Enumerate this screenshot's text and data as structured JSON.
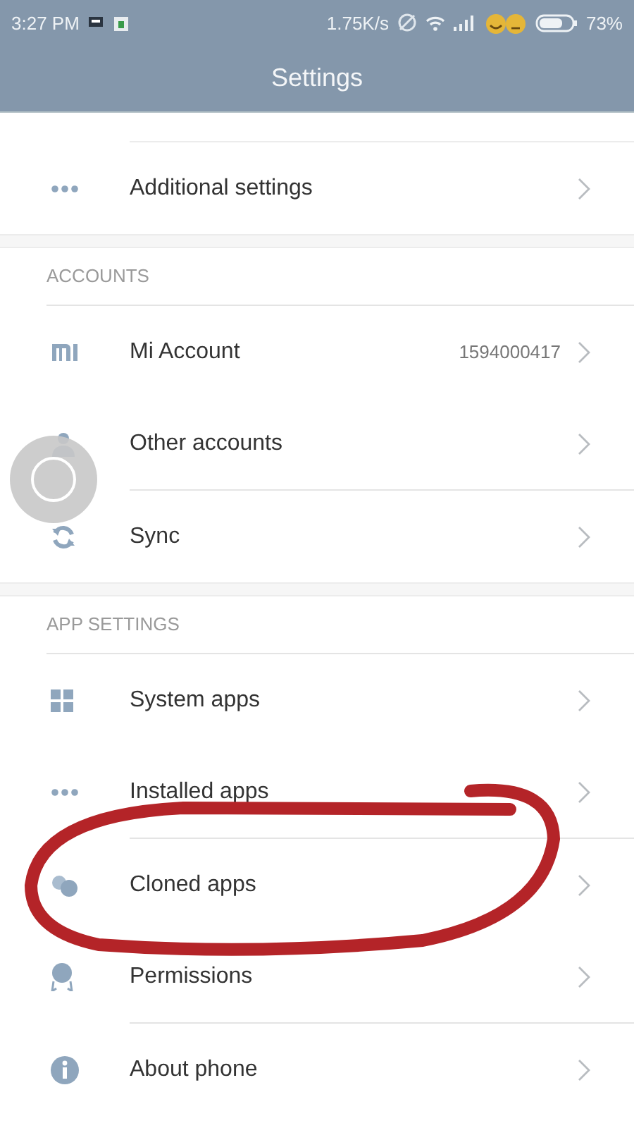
{
  "status_bar": {
    "time": "3:27 PM",
    "speed": "1.75K/s",
    "battery": "73%"
  },
  "window": {
    "title": "Settings"
  },
  "sections": [
    {
      "groups": [
        [
          {
            "label": "Additional settings"
          }
        ]
      ]
    },
    {
      "header": "ACCOUNTS",
      "groups": [
        [
          {
            "label": "Mi Account",
            "value": "1594000417"
          },
          {
            "label": "Other accounts"
          }
        ],
        [
          {
            "label": "Sync"
          }
        ]
      ]
    },
    {
      "header": "APP SETTINGS",
      "groups": [
        [
          {
            "label": "System apps"
          },
          {
            "label": "Installed apps"
          }
        ],
        [
          {
            "label": "Cloned apps"
          },
          {
            "label": "Permissions"
          }
        ],
        [
          {
            "label": "About phone"
          }
        ]
      ]
    }
  ]
}
